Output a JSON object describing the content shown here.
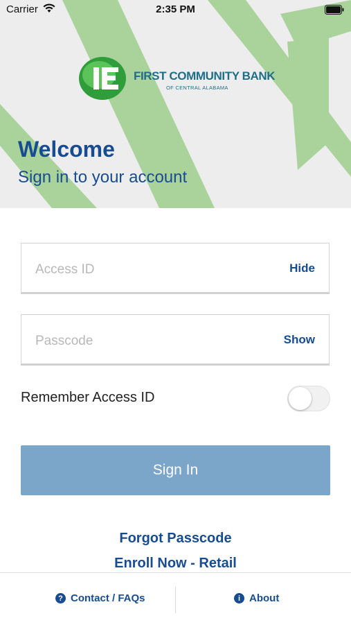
{
  "status_bar": {
    "carrier": "Carrier",
    "time": "2:35 PM"
  },
  "brand": {
    "name": "FIRST COMMUNITY BANK",
    "tagline": "OF CENTRAL ALABAMA",
    "logo_mark": "1E"
  },
  "hero": {
    "title": "Welcome",
    "subtitle": "Sign in to your account"
  },
  "form": {
    "access_id": {
      "placeholder": "Access ID",
      "toggle_label": "Hide"
    },
    "passcode": {
      "placeholder": "Passcode",
      "toggle_label": "Show"
    },
    "remember_label": "Remember Access ID",
    "remember_on": false,
    "submit_label": "Sign In"
  },
  "links": {
    "forgot": "Forgot Passcode",
    "enroll": "Enroll Now - Retail"
  },
  "footer": {
    "contact": "Contact / FAQs",
    "about": "About"
  },
  "colors": {
    "brand_blue": "#184c90",
    "button_blue": "#7ba5c9",
    "hero_green": "#a9d39b"
  }
}
